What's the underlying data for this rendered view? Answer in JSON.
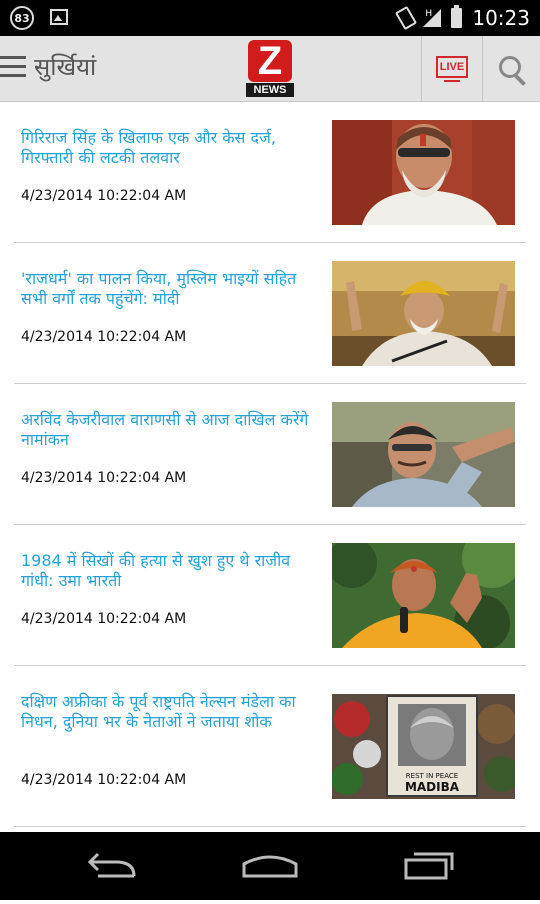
{
  "status_bar": {
    "notification_count": "83",
    "network_type": "H",
    "time": "10:23"
  },
  "app_bar": {
    "title": "सुर्खियां",
    "logo_letter": "Z",
    "logo_text": "NEWS",
    "live_label": "LIVE"
  },
  "articles": [
    {
      "title": "गिरिराज सिंह के खिलाफ एक और केस दर्ज, गिरफ्तारी की लटकी तलवार",
      "timestamp": "4/23/2014 10:22:04 AM"
    },
    {
      "title": "'राजधर्म' का पालन किया, मुस्लिम भाइयों सहित सभी वर्गों तक पहुंचेंगे: मोदी",
      "timestamp": "4/23/2014 10:22:04 AM"
    },
    {
      "title": "अरविंद केजरीवाल वाराणसी से आज दाखिल करेंगे नामांकन",
      "timestamp": "4/23/2014 10:22:04 AM"
    },
    {
      "title": "1984 में सिखों की हत्या से खुश हुए थे राजीव गांधी: उमा भारती",
      "timestamp": "4/23/2014 10:22:04 AM"
    },
    {
      "title": "दक्षिण अफ्रीका के पूर्व राष्ट्रपति नेल्सन मंडेला का निधन, दुनिया भर के नेताओं ने जताया शोक",
      "timestamp": "4/23/2014 10:22:04 AM"
    }
  ],
  "thumbnail_texts": {
    "madiba_sign_line1": "REST IN PEACE",
    "madiba_sign_line2": "MADIBA"
  },
  "colors": {
    "accent_red": "#d3262d",
    "headline_blue": "#25a3d8",
    "appbar_bg": "#e3e3e3"
  }
}
